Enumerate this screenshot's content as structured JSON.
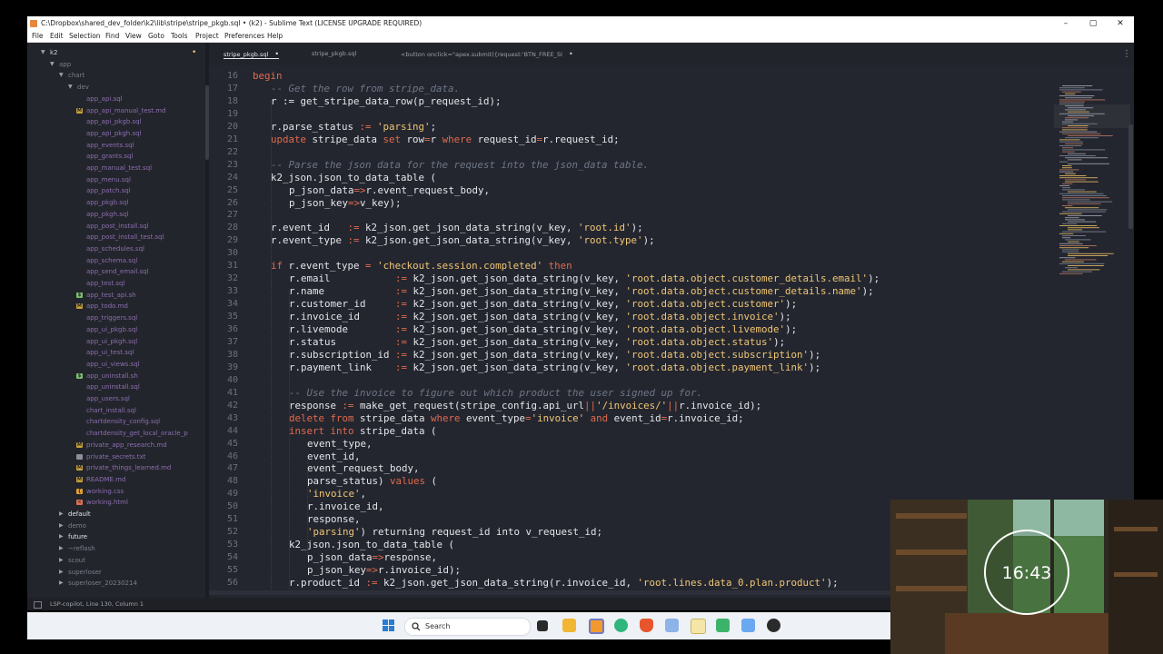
{
  "window": {
    "title": "C:\\Dropbox\\shared_dev_folder\\k2\\lib\\stripe\\stripe_pkgb.sql • (k2) - Sublime Text (LICENSE UPGRADE REQUIRED)",
    "controls": {
      "minimize": "–",
      "maximize": "▢",
      "close": "✕"
    }
  },
  "menu": [
    "File",
    "Edit",
    "Selection",
    "Find",
    "View",
    "Goto",
    "Tools",
    "Project",
    "Preferences",
    "Help"
  ],
  "tabs": [
    {
      "label": "stripe_pkgb.sql",
      "dirty": "•",
      "active": true
    },
    {
      "label": "stripe_pkgb.sql",
      "dirty": "",
      "active": false
    },
    {
      "label": "<button onclick=\"apex.submit({request:'BTN_FREE_SI",
      "dirty": "•",
      "active": false
    }
  ],
  "tab_menu_icon": "⋮",
  "sidebar": {
    "root": "k2",
    "root_dot": "•",
    "items": [
      {
        "label": "app",
        "indent": 1,
        "folder": true,
        "open": true
      },
      {
        "label": "chart",
        "indent": 2,
        "folder": true,
        "open": true
      },
      {
        "label": "dev",
        "indent": 3,
        "folder": true,
        "open": true
      },
      {
        "label": "app_api.sql",
        "indent": 4,
        "type": "sql"
      },
      {
        "label": "app_api_manual_test.md",
        "indent": 4,
        "type": "md"
      },
      {
        "label": "app_api_pkgb.sql",
        "indent": 4,
        "type": "sql"
      },
      {
        "label": "app_api_pkgh.sql",
        "indent": 4,
        "type": "sql"
      },
      {
        "label": "app_events.sql",
        "indent": 4,
        "type": "sql"
      },
      {
        "label": "app_grants.sql",
        "indent": 4,
        "type": "sql"
      },
      {
        "label": "app_manual_test.sql",
        "indent": 4,
        "type": "sql"
      },
      {
        "label": "app_menu.sql",
        "indent": 4,
        "type": "sql"
      },
      {
        "label": "app_patch.sql",
        "indent": 4,
        "type": "sql"
      },
      {
        "label": "app_pkgb.sql",
        "indent": 4,
        "type": "sql"
      },
      {
        "label": "app_pkgh.sql",
        "indent": 4,
        "type": "sql"
      },
      {
        "label": "app_post_install.sql",
        "indent": 4,
        "type": "sql"
      },
      {
        "label": "app_post_install_test.sql",
        "indent": 4,
        "type": "sql"
      },
      {
        "label": "app_schedules.sql",
        "indent": 4,
        "type": "sql"
      },
      {
        "label": "app_schema.sql",
        "indent": 4,
        "type": "sql"
      },
      {
        "label": "app_send_email.sql",
        "indent": 4,
        "type": "sql"
      },
      {
        "label": "app_test.sql",
        "indent": 4,
        "type": "sql"
      },
      {
        "label": "app_test_api.sh",
        "indent": 4,
        "type": "sh"
      },
      {
        "label": "app_todo.md",
        "indent": 4,
        "type": "md"
      },
      {
        "label": "app_triggers.sql",
        "indent": 4,
        "type": "sql"
      },
      {
        "label": "app_ui_pkgb.sql",
        "indent": 4,
        "type": "sql"
      },
      {
        "label": "app_ui_pkgh.sql",
        "indent": 4,
        "type": "sql"
      },
      {
        "label": "app_ui_test.sql",
        "indent": 4,
        "type": "sql"
      },
      {
        "label": "app_ui_views.sql",
        "indent": 4,
        "type": "sql"
      },
      {
        "label": "app_uninstall.sh",
        "indent": 4,
        "type": "sh"
      },
      {
        "label": "app_uninstall.sql",
        "indent": 4,
        "type": "sql"
      },
      {
        "label": "app_users.sql",
        "indent": 4,
        "type": "sql"
      },
      {
        "label": "chart_install.sql",
        "indent": 4,
        "type": "sql"
      },
      {
        "label": "chartdensity_config.sql",
        "indent": 4,
        "type": "sql"
      },
      {
        "label": "chartdensity_get_local_oracle_p",
        "indent": 4,
        "type": "sql"
      },
      {
        "label": "private_app_research.md",
        "indent": 4,
        "type": "md"
      },
      {
        "label": "private_secrets.txt",
        "indent": 4,
        "type": "txt"
      },
      {
        "label": "private_things_learned.md",
        "indent": 4,
        "type": "md"
      },
      {
        "label": "README.md",
        "indent": 4,
        "type": "md"
      },
      {
        "label": "working.css",
        "indent": 4,
        "type": "css"
      },
      {
        "label": "working.html",
        "indent": 4,
        "type": "html"
      },
      {
        "label": "default",
        "indent": 2,
        "folder": true,
        "open": false,
        "bright": true
      },
      {
        "label": "demo",
        "indent": 2,
        "folder": true,
        "open": false
      },
      {
        "label": "future",
        "indent": 2,
        "folder": true,
        "open": false,
        "bright": true
      },
      {
        "label": "~reflash",
        "indent": 2,
        "folder": true,
        "open": false
      },
      {
        "label": "scout",
        "indent": 2,
        "folder": true,
        "open": false
      },
      {
        "label": "superloser",
        "indent": 2,
        "folder": true,
        "open": false
      },
      {
        "label": "superloser_20230214",
        "indent": 2,
        "folder": true,
        "open": false
      }
    ]
  },
  "code": {
    "lines": [
      {
        "n": "16",
        "indent": 0,
        "t": [
          [
            "kw",
            "begin"
          ]
        ]
      },
      {
        "n": "17",
        "indent": 1,
        "t": [
          [
            "cm",
            "-- Get the row from stripe_data."
          ]
        ]
      },
      {
        "n": "18",
        "indent": 1,
        "t": [
          [
            "tx",
            "r := get_stripe_data_row(p_request_id);"
          ]
        ]
      },
      {
        "n": "19",
        "indent": 0,
        "t": []
      },
      {
        "n": "20",
        "indent": 1,
        "t": [
          [
            "tx",
            "r.parse_status "
          ],
          [
            "op",
            ":="
          ],
          [
            "tx",
            " "
          ],
          [
            "st",
            "'parsing'"
          ],
          [
            "tx",
            ";"
          ]
        ]
      },
      {
        "n": "21",
        "indent": 1,
        "t": [
          [
            "kw",
            "update"
          ],
          [
            "tx",
            " stripe_data "
          ],
          [
            "kw",
            "set"
          ],
          [
            "tx",
            " row"
          ],
          [
            "op",
            "="
          ],
          [
            "tx",
            "r "
          ],
          [
            "kw",
            "where"
          ],
          [
            "tx",
            " request_id"
          ],
          [
            "op",
            "="
          ],
          [
            "tx",
            "r.request_id;"
          ]
        ]
      },
      {
        "n": "22",
        "indent": 0,
        "t": []
      },
      {
        "n": "23",
        "indent": 1,
        "t": [
          [
            "cm",
            "-- Parse the json data for the request into the json_data table."
          ]
        ]
      },
      {
        "n": "24",
        "indent": 1,
        "t": [
          [
            "tx",
            "k2_json.json_to_data_table ("
          ]
        ]
      },
      {
        "n": "25",
        "indent": 2,
        "t": [
          [
            "tx",
            "p_json_data"
          ],
          [
            "op",
            "=>"
          ],
          [
            "tx",
            "r.event_request_body,"
          ]
        ]
      },
      {
        "n": "26",
        "indent": 2,
        "t": [
          [
            "tx",
            "p_json_key"
          ],
          [
            "op",
            "=>"
          ],
          [
            "tx",
            "v_key);"
          ]
        ]
      },
      {
        "n": "27",
        "indent": 0,
        "t": []
      },
      {
        "n": "28",
        "indent": 1,
        "t": [
          [
            "tx",
            "r.event_id   "
          ],
          [
            "op",
            ":="
          ],
          [
            "tx",
            " k2_json.get_json_data_string(v_key, "
          ],
          [
            "st",
            "'root.id'"
          ],
          [
            "tx",
            ");"
          ]
        ]
      },
      {
        "n": "29",
        "indent": 1,
        "t": [
          [
            "tx",
            "r.event_type "
          ],
          [
            "op",
            ":="
          ],
          [
            "tx",
            " k2_json.get_json_data_string(v_key, "
          ],
          [
            "st",
            "'root.type'"
          ],
          [
            "tx",
            ");"
          ]
        ]
      },
      {
        "n": "30",
        "indent": 0,
        "t": []
      },
      {
        "n": "31",
        "indent": 1,
        "t": [
          [
            "kw",
            "if"
          ],
          [
            "tx",
            " r.event_type "
          ],
          [
            "op",
            "="
          ],
          [
            "tx",
            " "
          ],
          [
            "st",
            "'checkout.session.completed'"
          ],
          [
            "tx",
            " "
          ],
          [
            "kw",
            "then"
          ]
        ]
      },
      {
        "n": "32",
        "indent": 2,
        "t": [
          [
            "tx",
            "r.email           "
          ],
          [
            "op",
            ":="
          ],
          [
            "tx",
            " k2_json.get_json_data_string(v_key, "
          ],
          [
            "st",
            "'root.data.object.customer_details.email'"
          ],
          [
            "tx",
            ");"
          ]
        ]
      },
      {
        "n": "33",
        "indent": 2,
        "t": [
          [
            "tx",
            "r.name            "
          ],
          [
            "op",
            ":="
          ],
          [
            "tx",
            " k2_json.get_json_data_string(v_key, "
          ],
          [
            "st",
            "'root.data.object.customer_details.name'"
          ],
          [
            "tx",
            ");"
          ]
        ]
      },
      {
        "n": "34",
        "indent": 2,
        "t": [
          [
            "tx",
            "r.customer_id     "
          ],
          [
            "op",
            ":="
          ],
          [
            "tx",
            " k2_json.get_json_data_string(v_key, "
          ],
          [
            "st",
            "'root.data.object.customer'"
          ],
          [
            "tx",
            ");"
          ]
        ]
      },
      {
        "n": "35",
        "indent": 2,
        "t": [
          [
            "tx",
            "r.invoice_id      "
          ],
          [
            "op",
            ":="
          ],
          [
            "tx",
            " k2_json.get_json_data_string(v_key, "
          ],
          [
            "st",
            "'root.data.object.invoice'"
          ],
          [
            "tx",
            ");"
          ]
        ]
      },
      {
        "n": "36",
        "indent": 2,
        "t": [
          [
            "tx",
            "r.livemode        "
          ],
          [
            "op",
            ":="
          ],
          [
            "tx",
            " k2_json.get_json_data_string(v_key, "
          ],
          [
            "st",
            "'root.data.object.livemode'"
          ],
          [
            "tx",
            ");"
          ]
        ]
      },
      {
        "n": "37",
        "indent": 2,
        "t": [
          [
            "tx",
            "r.status          "
          ],
          [
            "op",
            ":="
          ],
          [
            "tx",
            " k2_json.get_json_data_string(v_key, "
          ],
          [
            "st",
            "'root.data.object.status'"
          ],
          [
            "tx",
            ");"
          ]
        ]
      },
      {
        "n": "38",
        "indent": 2,
        "t": [
          [
            "tx",
            "r.subscription_id "
          ],
          [
            "op",
            ":="
          ],
          [
            "tx",
            " k2_json.get_json_data_string(v_key, "
          ],
          [
            "st",
            "'root.data.object.subscription'"
          ],
          [
            "tx",
            ");"
          ]
        ]
      },
      {
        "n": "39",
        "indent": 2,
        "t": [
          [
            "tx",
            "r.payment_link    "
          ],
          [
            "op",
            ":="
          ],
          [
            "tx",
            " k2_json.get_json_data_string(v_key, "
          ],
          [
            "st",
            "'root.data.object.payment_link'"
          ],
          [
            "tx",
            ");"
          ]
        ]
      },
      {
        "n": "40",
        "indent": 0,
        "t": []
      },
      {
        "n": "41",
        "indent": 2,
        "t": [
          [
            "cm",
            "-- Use the invoice to figure out which product the user signed up for."
          ]
        ]
      },
      {
        "n": "42",
        "indent": 2,
        "t": [
          [
            "tx",
            "response "
          ],
          [
            "op",
            ":="
          ],
          [
            "tx",
            " make_get_request(stripe_config.api_url"
          ],
          [
            "op",
            "||"
          ],
          [
            "st",
            "'/invoices/'"
          ],
          [
            "op",
            "||"
          ],
          [
            "tx",
            "r.invoice_id);"
          ]
        ]
      },
      {
        "n": "43",
        "indent": 2,
        "t": [
          [
            "kw",
            "delete from"
          ],
          [
            "tx",
            " stripe_data "
          ],
          [
            "kw",
            "where"
          ],
          [
            "tx",
            " event_type"
          ],
          [
            "op",
            "="
          ],
          [
            "st",
            "'invoice'"
          ],
          [
            "tx",
            " "
          ],
          [
            "kw",
            "and"
          ],
          [
            "tx",
            " event_id"
          ],
          [
            "op",
            "="
          ],
          [
            "tx",
            "r.invoice_id;"
          ]
        ]
      },
      {
        "n": "44",
        "indent": 2,
        "t": [
          [
            "kw",
            "insert into"
          ],
          [
            "tx",
            " stripe_data ("
          ]
        ]
      },
      {
        "n": "45",
        "indent": 3,
        "t": [
          [
            "tx",
            "event_type,"
          ]
        ]
      },
      {
        "n": "46",
        "indent": 3,
        "t": [
          [
            "tx",
            "event_id,"
          ]
        ]
      },
      {
        "n": "47",
        "indent": 3,
        "t": [
          [
            "tx",
            "event_request_body,"
          ]
        ]
      },
      {
        "n": "48",
        "indent": 3,
        "t": [
          [
            "tx",
            "parse_status) "
          ],
          [
            "kw",
            "values"
          ],
          [
            "tx",
            " ("
          ]
        ]
      },
      {
        "n": "49",
        "indent": 3,
        "t": [
          [
            "st",
            "'invoice'"
          ],
          [
            "tx",
            ","
          ]
        ]
      },
      {
        "n": "50",
        "indent": 3,
        "t": [
          [
            "tx",
            "r.invoice_id,"
          ]
        ]
      },
      {
        "n": "51",
        "indent": 3,
        "t": [
          [
            "tx",
            "response,"
          ]
        ]
      },
      {
        "n": "52",
        "indent": 3,
        "t": [
          [
            "st",
            "'parsing'"
          ],
          [
            "tx",
            ") returning request_id into v_request_id;"
          ]
        ]
      },
      {
        "n": "53",
        "indent": 2,
        "t": [
          [
            "tx",
            "k2_json.json_to_data_table ("
          ]
        ]
      },
      {
        "n": "54",
        "indent": 3,
        "t": [
          [
            "tx",
            "p_json_data"
          ],
          [
            "op",
            "=>"
          ],
          [
            "tx",
            "response,"
          ]
        ]
      },
      {
        "n": "55",
        "indent": 3,
        "t": [
          [
            "tx",
            "p_json_key"
          ],
          [
            "op",
            "=>"
          ],
          [
            "tx",
            "r.invoice_id);"
          ]
        ]
      },
      {
        "n": "56",
        "indent": 2,
        "t": [
          [
            "tx",
            "r.product_id "
          ],
          [
            "op",
            ":="
          ],
          [
            "tx",
            " k2_json.get_json_data_string(r.invoice_id, "
          ],
          [
            "st",
            "'root.lines.data_0.plan.product'"
          ],
          [
            "tx",
            ");"
          ]
        ]
      }
    ]
  },
  "status_bar": {
    "text": "LSP-copilot, Line 130, Column 1"
  },
  "taskbar": {
    "search_placeholder": "Search"
  },
  "webcam": {
    "clock": "16:43"
  },
  "colors": {
    "keyword": "#e06a4e",
    "string": "#f0c674",
    "comment": "#6d7686",
    "operator": "#e06a4e",
    "text": "#e4e6ea",
    "sidebar_file": "#8c6fb0",
    "sidebar_folder": "#7a7f8b"
  }
}
